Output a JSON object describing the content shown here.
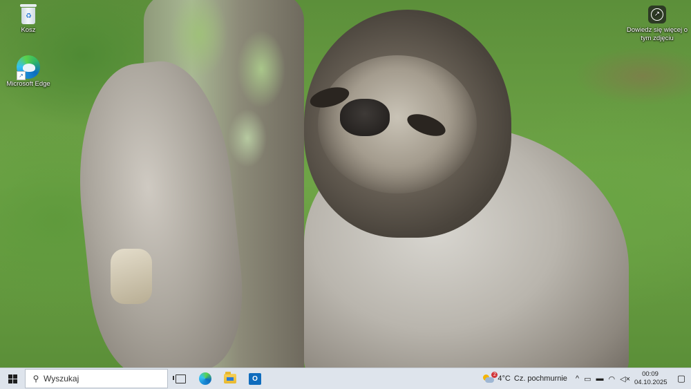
{
  "desktop": {
    "icons": [
      {
        "label": "Kosz",
        "icon": "recycle-bin-icon"
      },
      {
        "label": "Microsoft Edge",
        "icon": "edge-icon"
      }
    ],
    "learn_more": {
      "label": "Dowiedz się więcej o tym zdjęciu",
      "icon": "camera-info-icon"
    }
  },
  "taskbar": {
    "start_icon": "windows-logo-icon",
    "search_placeholder": "Wyszukaj",
    "apps": [
      {
        "name": "Widok zadań",
        "icon": "task-view-icon"
      },
      {
        "name": "Microsoft Edge",
        "icon": "edge-icon"
      },
      {
        "name": "Eksplorator plików",
        "icon": "folder-icon"
      },
      {
        "name": "Outlook",
        "icon": "outlook-icon"
      }
    ],
    "weather": {
      "badge": "2",
      "temperature": "4°C",
      "condition": "Cz. pochmurnie"
    },
    "tray": {
      "chevron": "^",
      "time": "00:09",
      "date": "04.10.2025"
    }
  }
}
